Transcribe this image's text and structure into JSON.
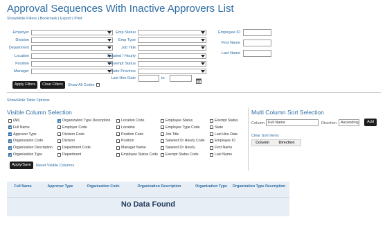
{
  "page": {
    "title": "Approval Sequences With Inactive Approvers List",
    "top_links": "Show/Hide Filters | Bookmark | Export | Print"
  },
  "filters": {
    "col1": [
      {
        "label": "Employer"
      },
      {
        "label": "Division"
      },
      {
        "label": "Department"
      },
      {
        "label": "Location"
      },
      {
        "label": "Position"
      },
      {
        "label": "Manager"
      }
    ],
    "col2": [
      {
        "label": "Emp Status"
      },
      {
        "label": "Emp Type"
      },
      {
        "label": "Job Title"
      },
      {
        "label": "Salaried / Hourly"
      },
      {
        "label": "Exempt Status"
      },
      {
        "label": "State Province"
      }
    ],
    "col3": [
      {
        "label": "Employee ID"
      },
      {
        "label": "First Name"
      },
      {
        "label": "Last Name"
      }
    ],
    "last_hire_date_label": "Last Hire Date",
    "to_label": "to",
    "apply_label": "Apply Filters",
    "clear_label": "Clear Filters",
    "show_all_codes_label": "Show All Codes"
  },
  "table_options_link": "Show/Hide Table Options",
  "visible_columns": {
    "heading": "Visible Column Selection",
    "columns": [
      [
        {
          "label": "(All)",
          "checked": false
        },
        {
          "label": "Full Name",
          "checked": true
        },
        {
          "label": "Approver Type",
          "checked": true
        },
        {
          "label": "Organization Code",
          "checked": true
        },
        {
          "label": "Organization Description",
          "checked": true
        },
        {
          "label": "Organization Type",
          "checked": true
        }
      ],
      [
        {
          "label": "Organization Type Description",
          "checked": true
        },
        {
          "label": "Employer Code",
          "checked": false
        },
        {
          "label": "Division Code",
          "checked": false
        },
        {
          "label": "Division",
          "checked": false
        },
        {
          "label": "Department Code",
          "checked": false
        },
        {
          "label": "Department",
          "checked": false
        }
      ],
      [
        {
          "label": "Location Code",
          "checked": false
        },
        {
          "label": "Location",
          "checked": false
        },
        {
          "label": "Position Code",
          "checked": false
        },
        {
          "label": "Position",
          "checked": false
        },
        {
          "label": "Manager Name",
          "checked": false
        },
        {
          "label": "Employee Status Code",
          "checked": false
        }
      ],
      [
        {
          "label": "Employee Status",
          "checked": false
        },
        {
          "label": "Employee Type Code",
          "checked": false
        },
        {
          "label": "Job Title",
          "checked": false
        },
        {
          "label": "Salaried Or Hourly Code",
          "checked": false
        },
        {
          "label": "Salaried Or Hourly",
          "checked": false
        },
        {
          "label": "Exempt Status Code",
          "checked": false
        }
      ],
      [
        {
          "label": "Exempt Status",
          "checked": false
        },
        {
          "label": "State",
          "checked": false
        },
        {
          "label": "Last Hire Date",
          "checked": false
        },
        {
          "label": "Employee ID",
          "checked": false
        },
        {
          "label": "First Name",
          "checked": false
        },
        {
          "label": "Last Name",
          "checked": false
        }
      ]
    ],
    "apply_save_label": "Apply/Save",
    "reset_label": "Reset Visible Columns"
  },
  "multi_sort": {
    "heading": "Multi Column Sort Selection",
    "column_label": "Column",
    "column_value": "Full Name",
    "direction_label": "Direction",
    "direction_value": "Ascending",
    "add_label": "Add",
    "clear_sort_label": "Clear Sort Items",
    "table_headers": [
      "Column",
      "Direction"
    ]
  },
  "results": {
    "headers": [
      "Full Name",
      "Approver Type",
      "Organization Code",
      "Organization Description",
      "Organization Type",
      "Organization Type Description"
    ],
    "empty_message": "No Data Found"
  },
  "colors": {
    "accent": "#2c6ca3",
    "button": "#1c1c1c",
    "results_bg": "#e8eef5"
  }
}
